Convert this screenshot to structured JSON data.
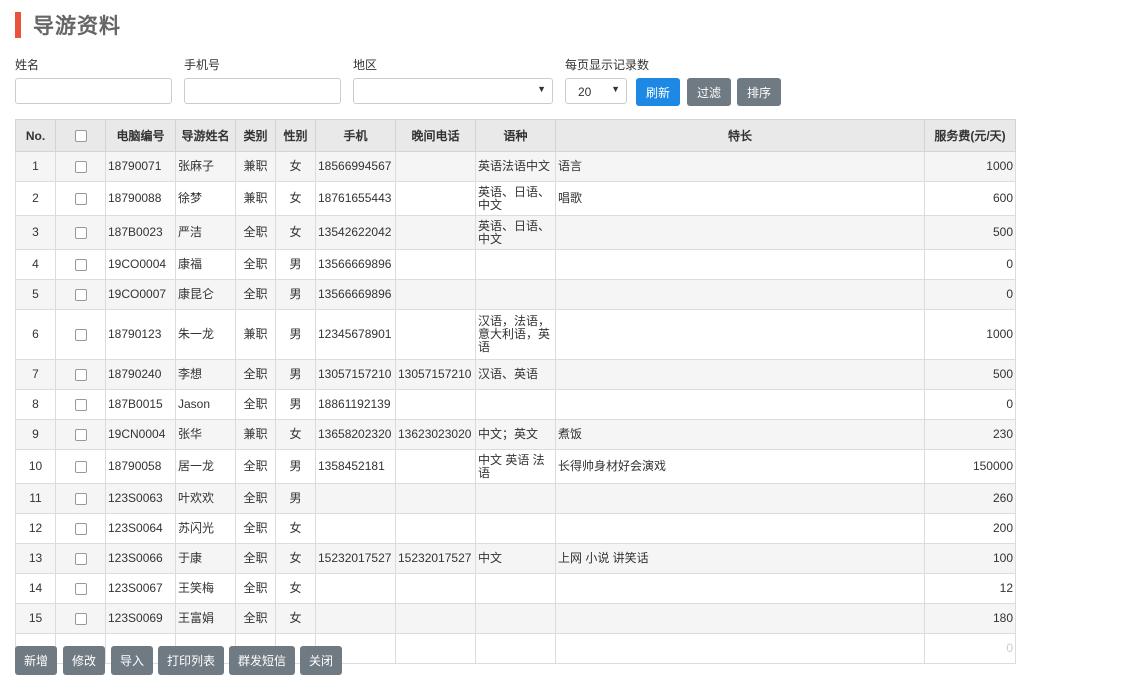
{
  "page": {
    "title": "导游资料"
  },
  "filters": {
    "name_label": "姓名",
    "phone_label": "手机号",
    "region_label": "地区",
    "page_size_label": "每页显示记录数",
    "page_size_value": "20",
    "refresh_label": "刷新",
    "filter_label": "过滤",
    "sort_label": "排序"
  },
  "table": {
    "columns": [
      "No.",
      "",
      "电脑编号",
      "导游姓名",
      "类别",
      "性别",
      "手机",
      "晚间电话",
      "语种",
      "特长",
      "服务费(元/天)"
    ],
    "rows": [
      {
        "no": "1",
        "code": "18790071",
        "name": "张麻子",
        "type": "兼职",
        "gender": "女",
        "mobile": "18566994567",
        "night": "",
        "lang": "英语法语中文",
        "skill": "语言",
        "fee": "1000"
      },
      {
        "no": "2",
        "code": "18790088",
        "name": "徐梦",
        "type": "兼职",
        "gender": "女",
        "mobile": "18761655443",
        "night": "",
        "lang": "英语、日语、中文",
        "skill": "唱歌",
        "fee": "600"
      },
      {
        "no": "3",
        "code": "187B0023",
        "name": "严洁",
        "type": "全职",
        "gender": "女",
        "mobile": "13542622042",
        "night": "",
        "lang": "英语、日语、中文",
        "skill": "",
        "fee": "500"
      },
      {
        "no": "4",
        "code": "19CO0004",
        "name": "康福",
        "type": "全职",
        "gender": "男",
        "mobile": "13566669896",
        "night": "",
        "lang": "",
        "skill": "",
        "fee": "0"
      },
      {
        "no": "5",
        "code": "19CO0007",
        "name": "康昆仑",
        "type": "全职",
        "gender": "男",
        "mobile": "13566669896",
        "night": "",
        "lang": "",
        "skill": "",
        "fee": "0"
      },
      {
        "no": "6",
        "code": "18790123",
        "name": "朱一龙",
        "type": "兼职",
        "gender": "男",
        "mobile": "12345678901",
        "night": "",
        "lang": "汉语，法语，意大利语，英语",
        "skill": "",
        "fee": "1000"
      },
      {
        "no": "7",
        "code": "18790240",
        "name": "李想",
        "type": "全职",
        "gender": "男",
        "mobile": "13057157210",
        "night": "13057157210",
        "lang": "汉语、英语",
        "skill": "",
        "fee": "500"
      },
      {
        "no": "8",
        "code": "187B0015",
        "name": "Jason",
        "type": "全职",
        "gender": "男",
        "mobile": "18861192139",
        "night": "",
        "lang": "",
        "skill": "",
        "fee": "0"
      },
      {
        "no": "9",
        "code": "19CN0004",
        "name": "张华",
        "type": "兼职",
        "gender": "女",
        "mobile": "13658202320",
        "night": "13623023020",
        "lang": "中文；英文",
        "skill": "煮饭",
        "fee": "230"
      },
      {
        "no": "10",
        "code": "18790058",
        "name": "居一龙",
        "type": "全职",
        "gender": "男",
        "mobile": "1358452181",
        "night": "",
        "lang": "中文 英语 法语",
        "skill": "长得帅身材好会演戏",
        "fee": "150000"
      },
      {
        "no": "11",
        "code": "123S0063",
        "name": "叶欢欢",
        "type": "全职",
        "gender": "男",
        "mobile": "",
        "night": "",
        "lang": "",
        "skill": "",
        "fee": "260"
      },
      {
        "no": "12",
        "code": "123S0064",
        "name": "苏闪光",
        "type": "全职",
        "gender": "女",
        "mobile": "",
        "night": "",
        "lang": "",
        "skill": "",
        "fee": "200"
      },
      {
        "no": "13",
        "code": "123S0066",
        "name": "于康",
        "type": "全职",
        "gender": "女",
        "mobile": "15232017527",
        "night": "15232017527",
        "lang": "中文",
        "skill": "上网 小说 讲笑话",
        "fee": "100"
      },
      {
        "no": "14",
        "code": "123S0067",
        "name": "王笑梅",
        "type": "全职",
        "gender": "女",
        "mobile": "",
        "night": "",
        "lang": "",
        "skill": "",
        "fee": "12"
      },
      {
        "no": "15",
        "code": "123S0069",
        "name": "王富娟",
        "type": "全职",
        "gender": "女",
        "mobile": "",
        "night": "",
        "lang": "",
        "skill": "",
        "fee": "180"
      },
      {
        "no": "",
        "code": "",
        "name": "",
        "type": "",
        "gender": "",
        "mobile": "",
        "night": "",
        "lang": "",
        "skill": "",
        "fee": "0"
      }
    ]
  },
  "actions": {
    "add": "新增",
    "edit": "修改",
    "import": "导入",
    "print": "打印列表",
    "sms": "群发短信",
    "close": "关闭"
  },
  "colors": {
    "accent": "#e8533a",
    "primary": "#1e88e5",
    "secondary": "#707a83"
  }
}
